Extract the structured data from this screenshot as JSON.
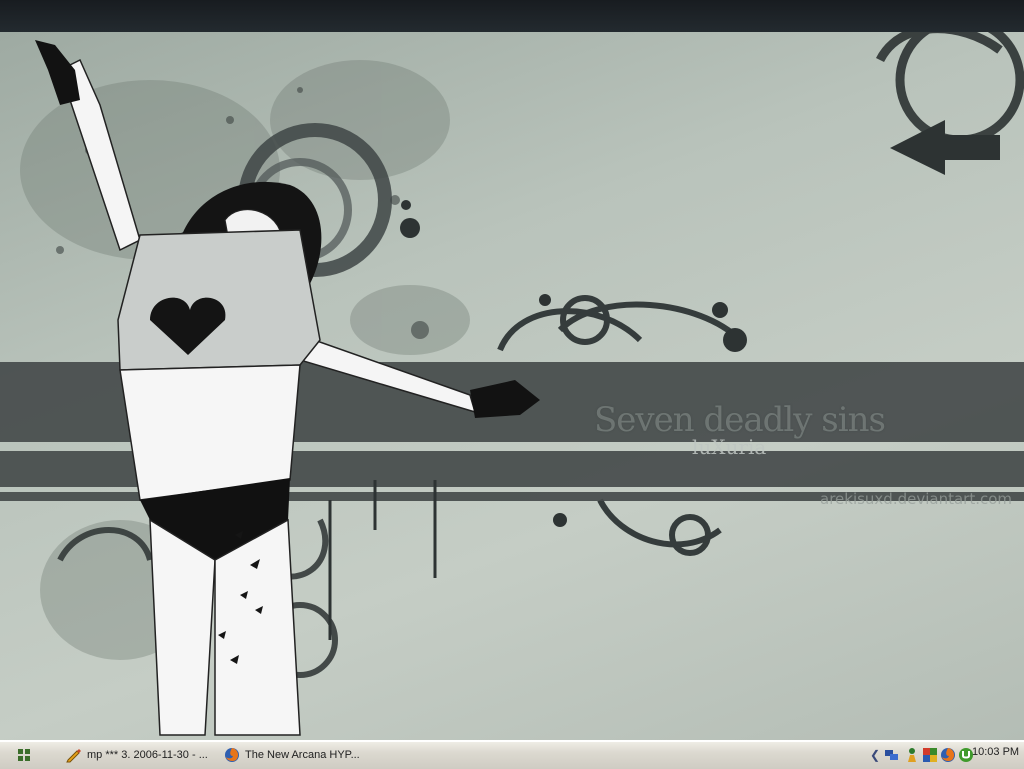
{
  "wallpaper": {
    "title": "Seven deadly sins",
    "subtitle": "luXuria",
    "credit": "arekisuxd.deviantart.com"
  },
  "taskbar": {
    "start_icon": "windows-grid-icon",
    "tasks": [
      {
        "label": "mp *** 3. 2006-11-30 - ...",
        "icon": "pencil-icon"
      },
      {
        "label": "The New Arcana HYP...",
        "icon": "firefox-icon"
      }
    ],
    "tray": {
      "icons": [
        "chevron-left-icon",
        "network-icon",
        "pawn-icon",
        "grid-app-icon",
        "firefox-tray-icon",
        "utorrent-icon"
      ],
      "clock": "10:03 PM"
    }
  },
  "colors": {
    "banner": "#454b4b",
    "wallpaper": "#b9c3bb",
    "taskbar": "#dcd9d0"
  }
}
